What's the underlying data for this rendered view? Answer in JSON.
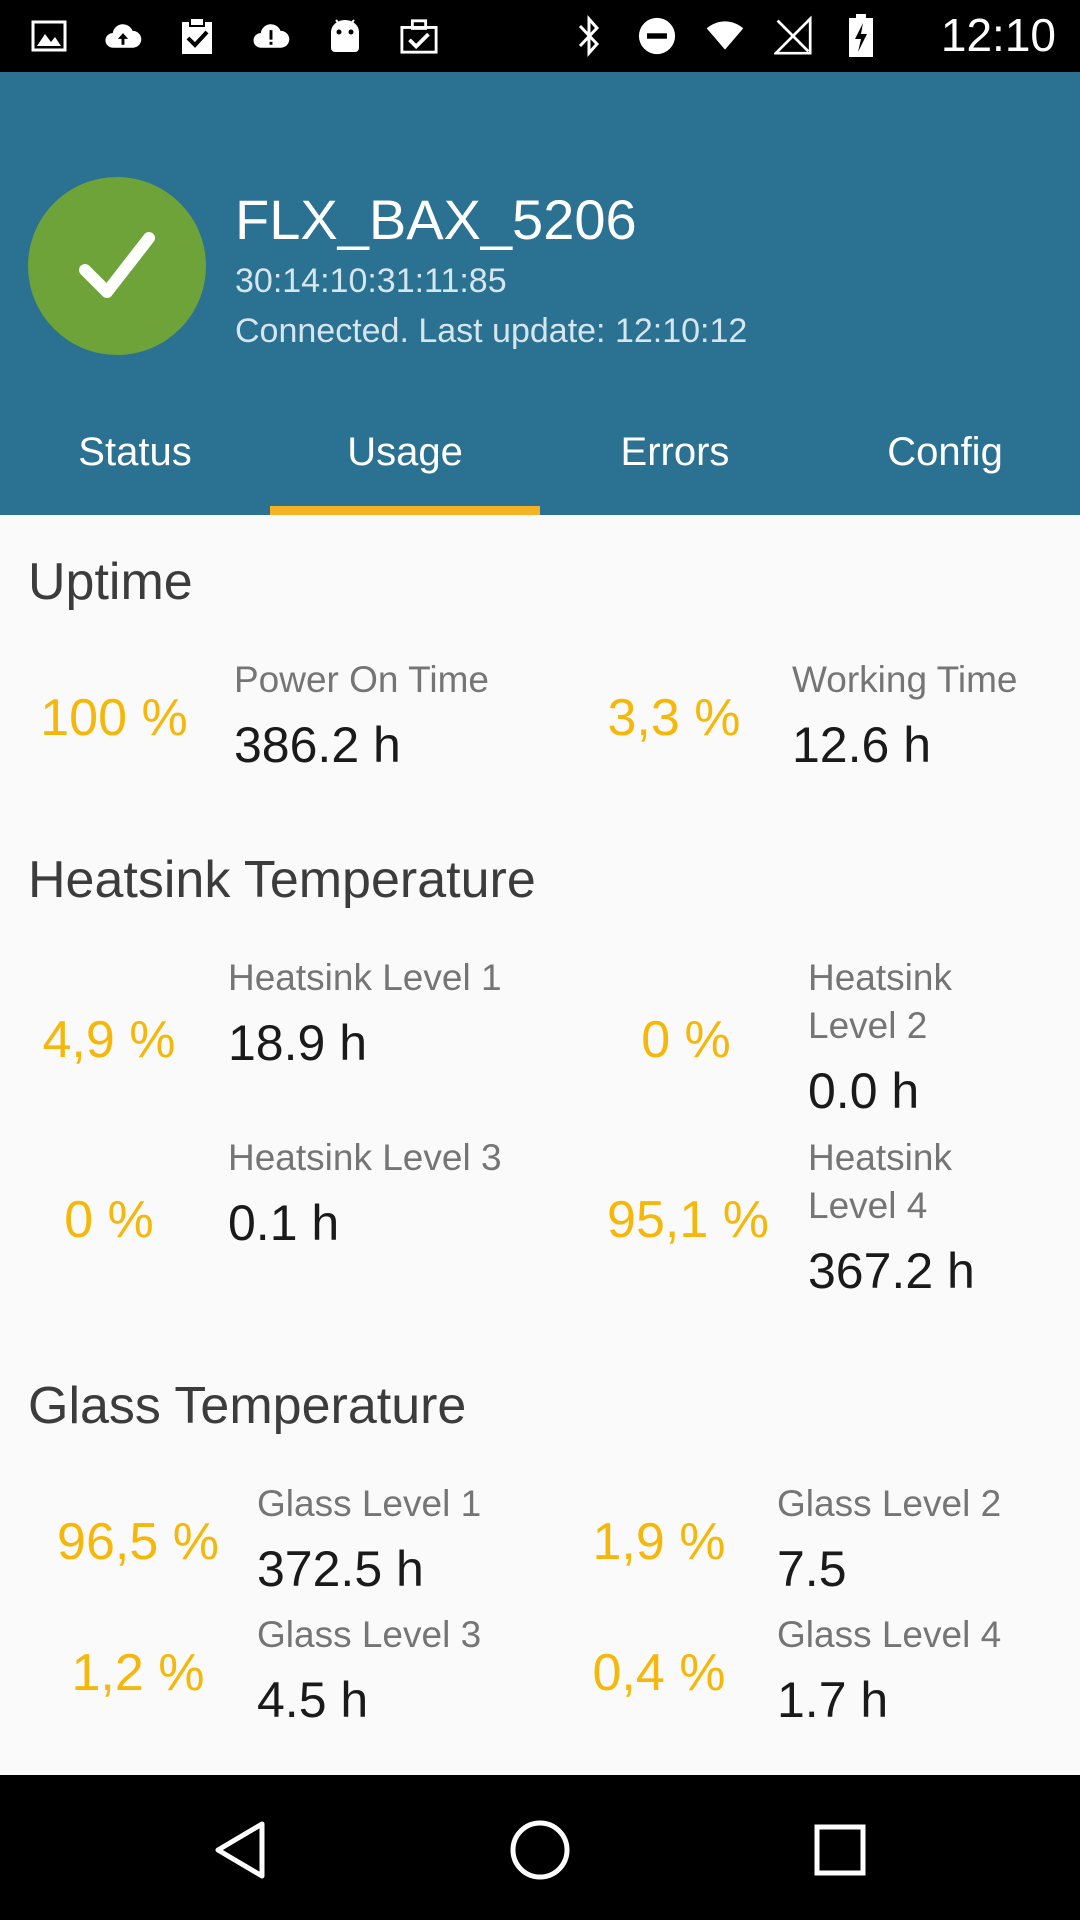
{
  "status_bar": {
    "time": "12:10",
    "left_icons": [
      "image-icon",
      "cloud-upload-icon",
      "clipboard-check-icon",
      "cloud-alert-icon",
      "android-icon",
      "briefcase-check-icon"
    ],
    "right_icons": [
      "bluetooth-icon",
      "do-not-disturb-icon",
      "wifi-icon",
      "no-signal-icon",
      "battery-charging-icon"
    ]
  },
  "device": {
    "name": "FLX_BAX_5206",
    "mac": "30:14:10:31:11:85",
    "status": "Connected. Last update: 12:10:12",
    "status_icon": "check-icon",
    "status_color": "#6ea33a"
  },
  "tabs": [
    {
      "label": "Status",
      "active": false
    },
    {
      "label": "Usage",
      "active": true
    },
    {
      "label": "Errors",
      "active": false
    },
    {
      "label": "Config",
      "active": false
    }
  ],
  "uptime": {
    "title": "Uptime",
    "items": [
      {
        "pct": "100 %",
        "label": "Power On Time",
        "value": "386.2 h"
      },
      {
        "pct": "3,3 %",
        "label": "Working Time",
        "value": "12.6 h"
      }
    ]
  },
  "heatsink": {
    "title": "Heatsink Temperature",
    "items": [
      {
        "pct": "4,9 %",
        "label": "Heatsink Level 1",
        "value": "18.9 h"
      },
      {
        "pct": "0 %",
        "label": "Heatsink Level 2",
        "value": "0.0 h"
      },
      {
        "pct": "0 %",
        "label": "Heatsink Level 3",
        "value": "0.1 h"
      },
      {
        "pct": "95,1 %",
        "label": "Heatsink Level 4",
        "value": "367.2 h"
      }
    ]
  },
  "glass": {
    "title": "Glass Temperature",
    "items": [
      {
        "pct": "96,5 %",
        "label": "Glass Level 1",
        "value": "372.5 h"
      },
      {
        "pct": "1,9 %",
        "label": "Glass Level 2",
        "value": "7.5"
      },
      {
        "pct": "1,2 %",
        "label": "Glass Level 3",
        "value": "4.5 h"
      },
      {
        "pct": "0,4 %",
        "label": "Glass Level 4",
        "value": "1.7 h"
      }
    ]
  },
  "nav": [
    "back-icon",
    "home-icon",
    "recents-icon"
  ],
  "colors": {
    "header": "#2a7192",
    "accent": "#f5b324",
    "percent": "#f5b80a"
  }
}
